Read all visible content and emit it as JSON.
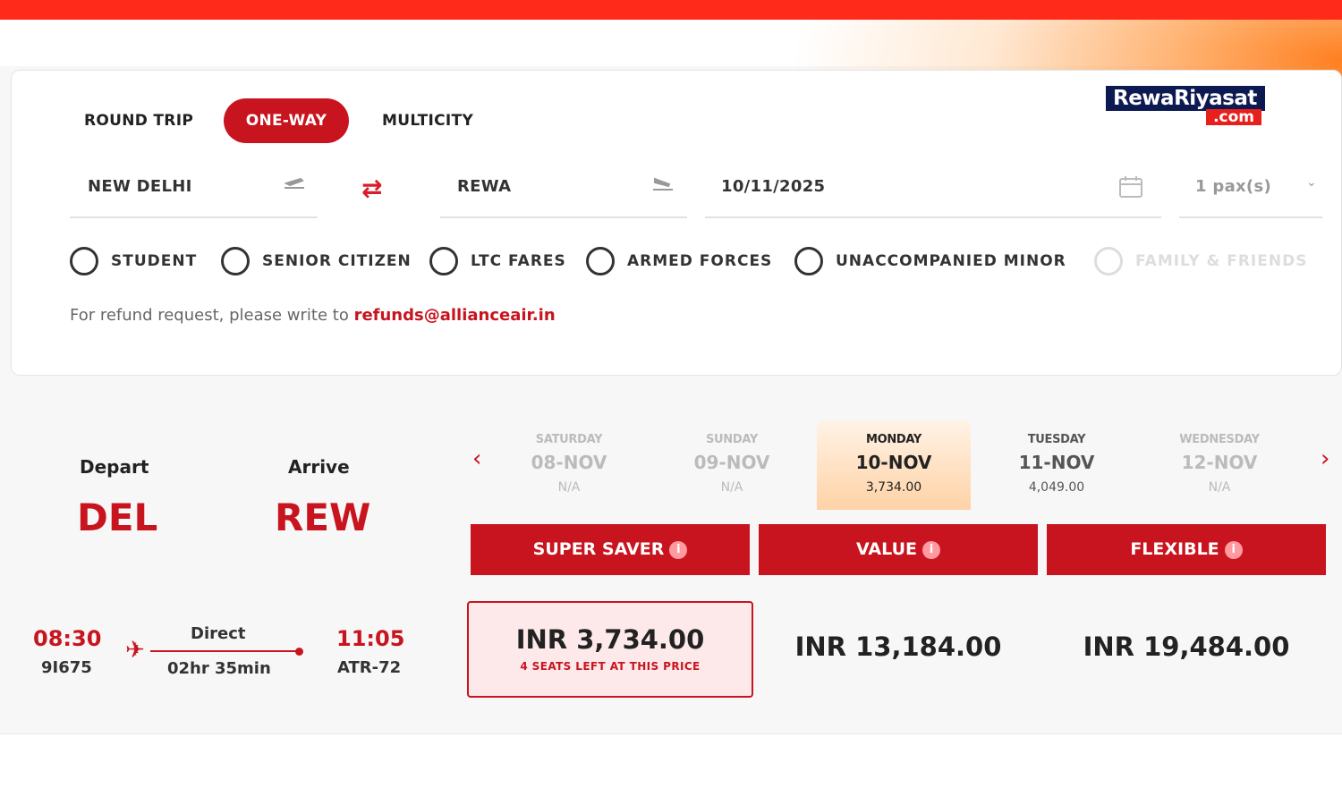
{
  "brand": {
    "logo_line1": "RewaRiyasat",
    "logo_line2": ".com"
  },
  "trip_types": [
    {
      "label": "ROUND TRIP",
      "active": false
    },
    {
      "label": "ONE-WAY",
      "active": true
    },
    {
      "label": "MULTICITY",
      "active": false
    }
  ],
  "search": {
    "from": "NEW DELHI",
    "to": "REWA",
    "date": "10/11/2025",
    "pax": "1 pax(s)"
  },
  "concessions": [
    "STUDENT",
    "SENIOR CITIZEN",
    "LTC FARES",
    "ARMED FORCES",
    "UNACCOMPANIED MINOR",
    "FAMILY & FRIENDS"
  ],
  "refund": {
    "text": "For refund request, please write to ",
    "email": "refunds@allianceair.in"
  },
  "route": {
    "depart_label": "Depart",
    "arrive_label": "Arrive",
    "from_code": "DEL",
    "to_code": "REW"
  },
  "dates": [
    {
      "weekday": "SATURDAY",
      "date": "08-NOV",
      "price": "N/A"
    },
    {
      "weekday": "SUNDAY",
      "date": "09-NOV",
      "price": "N/A"
    },
    {
      "weekday": "MONDAY",
      "date": "10-NOV",
      "price": "3,734.00"
    },
    {
      "weekday": "TUESDAY",
      "date": "11-NOV",
      "price": "4,049.00"
    },
    {
      "weekday": "WEDNESDAY",
      "date": "12-NOV",
      "price": "N/A"
    }
  ],
  "fare_types": [
    "SUPER SAVER",
    "VALUE",
    "FLEXIBLE"
  ],
  "flight": {
    "dep_time": "08:30",
    "flight_no": "9I675",
    "stops": "Direct",
    "duration": "02hr 35min",
    "arr_time": "11:05",
    "aircraft": "ATR-72"
  },
  "prices": {
    "super_saver": "INR 3,734.00",
    "seats_left": "4 SEATS LEFT AT THIS PRICE",
    "value": "INR 13,184.00",
    "flexible": "INR 19,484.00"
  },
  "colors": {
    "accent": "#c8141e",
    "topbar": "#ff2a1a"
  },
  "icons": [
    "takeoff-icon",
    "landing-icon",
    "swap-icon",
    "calendar-icon",
    "chevron-down-icon",
    "chevron-left-icon",
    "chevron-right-icon",
    "info-icon",
    "plane-icon"
  ]
}
